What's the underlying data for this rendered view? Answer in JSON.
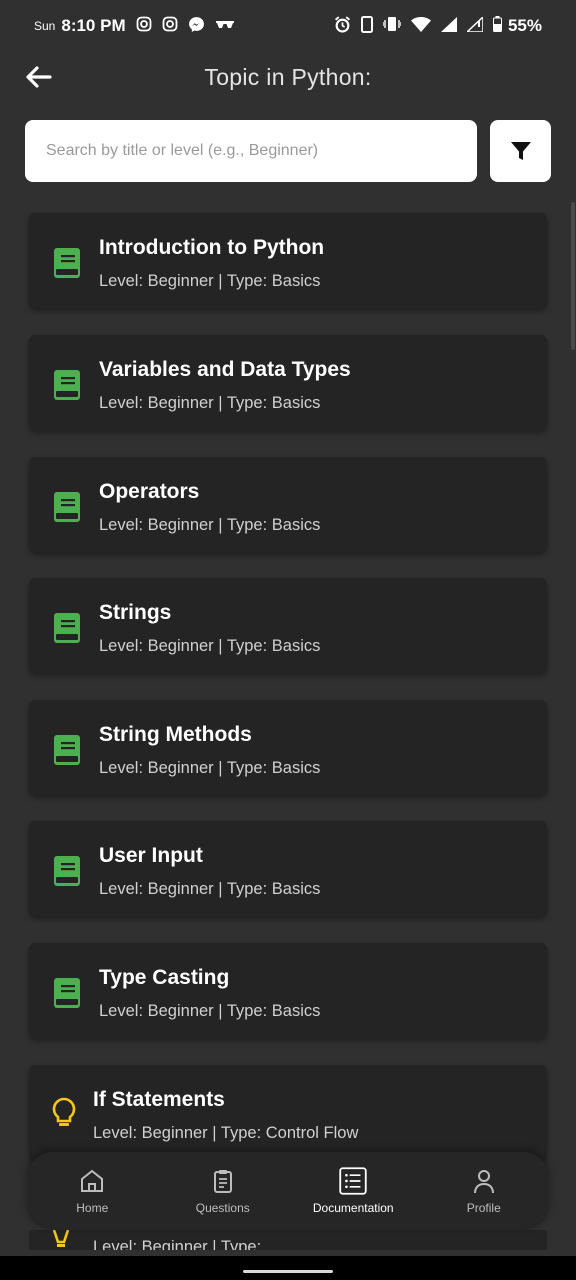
{
  "status_bar": {
    "day": "Sun",
    "time": "8:10 PM",
    "battery": "55%"
  },
  "app_bar": {
    "title": "Topic in Python:"
  },
  "search": {
    "placeholder": "Search by title or level (e.g., Beginner)"
  },
  "topics": [
    {
      "title": "Introduction to Python",
      "subtitle": "Level: Beginner | Type: Basics",
      "icon": "book-icon"
    },
    {
      "title": "Variables and Data Types",
      "subtitle": "Level: Beginner | Type: Basics",
      "icon": "book-icon"
    },
    {
      "title": "Operators",
      "subtitle": "Level: Beginner | Type: Basics",
      "icon": "book-icon"
    },
    {
      "title": "Strings",
      "subtitle": "Level: Beginner | Type: Basics",
      "icon": "book-icon"
    },
    {
      "title": "String Methods",
      "subtitle": "Level: Beginner | Type: Basics",
      "icon": "book-icon"
    },
    {
      "title": "User Input",
      "subtitle": "Level: Beginner | Type: Basics",
      "icon": "book-icon"
    },
    {
      "title": "Type Casting",
      "subtitle": "Level: Beginner | Type: Basics",
      "icon": "book-icon"
    },
    {
      "title": "If Statements",
      "subtitle": "Level: Beginner | Type: Control Flow",
      "icon": "lightbulb-icon"
    }
  ],
  "partial_item": {
    "subtitle": "Level: Beginner | Type: ..."
  },
  "bottom_nav": [
    {
      "label": "Home",
      "icon": "home-icon",
      "active": false
    },
    {
      "label": "Questions",
      "icon": "clipboard-icon",
      "active": false
    },
    {
      "label": "Documentation",
      "icon": "list-icon",
      "active": true
    },
    {
      "label": "Profile",
      "icon": "person-icon",
      "active": false
    }
  ],
  "colors": {
    "background": "#303030",
    "card": "#242424",
    "book_icon": "#4caf50",
    "bulb_icon": "#f5c518"
  }
}
